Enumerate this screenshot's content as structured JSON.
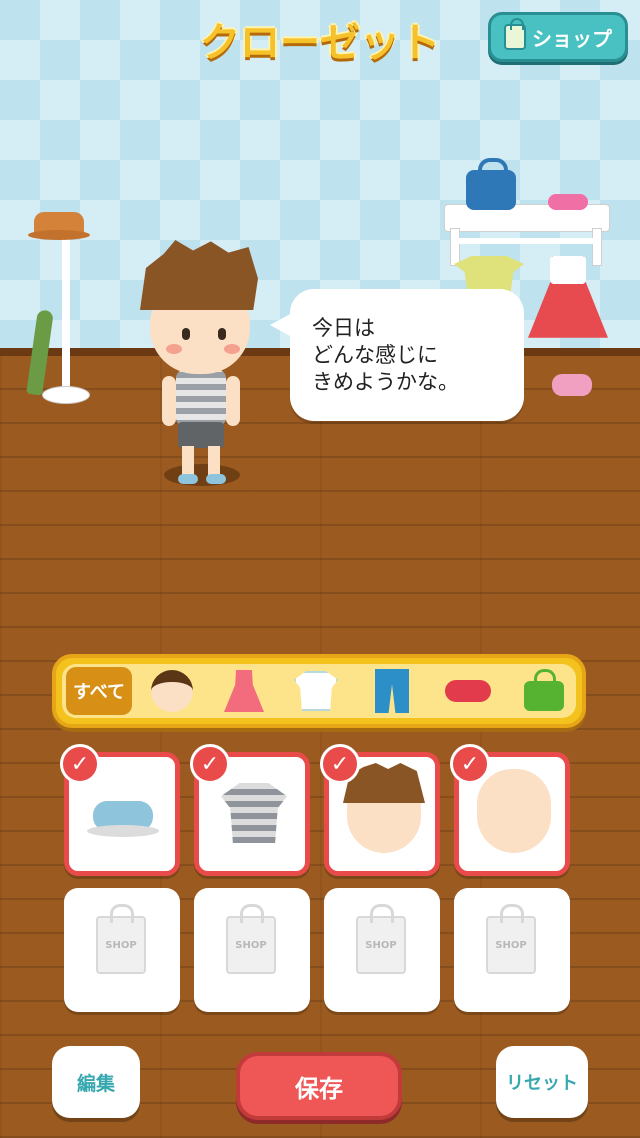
{
  "header": {
    "title": "クローゼット",
    "shop_label": "ショップ"
  },
  "speech_bubble": {
    "lines": [
      "今日は",
      "どんな感じに",
      "きめようかな。"
    ]
  },
  "category_tabs": {
    "all_label": "すべて",
    "tabs": [
      "all",
      "face-hair",
      "dress",
      "tops",
      "bottoms",
      "shoes",
      "bag"
    ],
    "selected": "all"
  },
  "items": {
    "selected": [
      {
        "kind": "shoes",
        "checked": true
      },
      {
        "kind": "tops",
        "checked": true
      },
      {
        "kind": "hair",
        "checked": true
      },
      {
        "kind": "face",
        "checked": true
      }
    ],
    "empty_slot_label": "SHOP",
    "empty_slots": 4
  },
  "buttons": {
    "edit_label": "編集",
    "save_label": "保存",
    "reset_label": "リセット"
  },
  "colors": {
    "accent_red": "#e94b4b",
    "tab_bar": "#f3c21c",
    "button_text_teal": "#37a7b0",
    "shop_button": "#49c1c2"
  }
}
